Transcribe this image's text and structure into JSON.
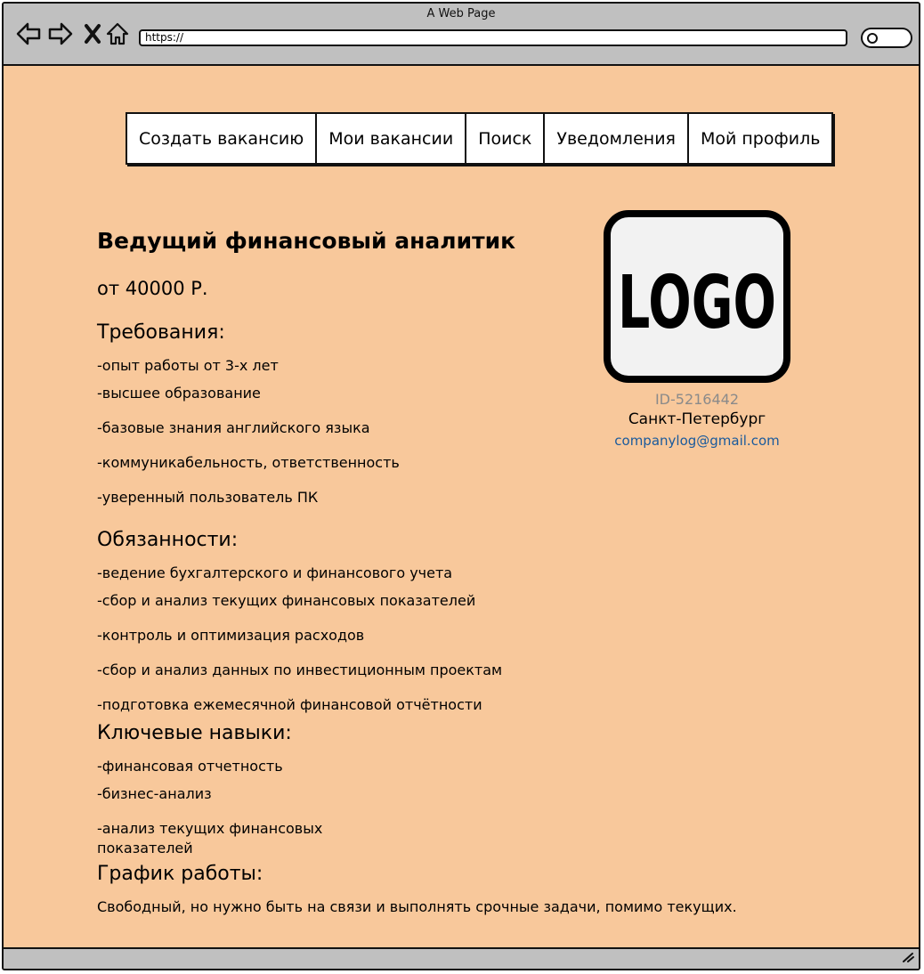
{
  "browser": {
    "title": "A Web Page",
    "url": "https://"
  },
  "menu": [
    {
      "label": "Создать вакансию"
    },
    {
      "label": "Мои вакансии"
    },
    {
      "label": "Поиск"
    },
    {
      "label": "Уведомления"
    },
    {
      "label": "Мой профиль"
    }
  ],
  "job": {
    "title": "Ведущий финансовый аналитик",
    "salary": "от 40000 Р."
  },
  "sections": {
    "requirements": {
      "title": "Требования:",
      "items": [
        "-опыт работы от 3-х лет",
        "-высшее образование",
        "-базовые знания английского языка",
        "-коммуникабельность, ответственность",
        "-уверенный пользователь ПК"
      ]
    },
    "duties": {
      "title": "Обязанности:",
      "items": [
        "-ведение бухгалтерского и финансового учета",
        "-сбор и анализ текущих финансовых показателей",
        "-контроль и оптимизация расходов",
        "-сбор и анализ данных по инвестиционным проектам",
        "-подготовка ежемесячной финансовой отчётности"
      ]
    },
    "skills": {
      "title": "Ключевые навыки:",
      "items": [
        "-финансовая отчетность",
        "-бизнес-анализ",
        "-анализ текущих финансовых",
        "показателей"
      ]
    },
    "schedule": {
      "title": "График работы:",
      "text": "Свободный, но нужно быть на связи и выполнять срочные задачи, помимо текущих."
    }
  },
  "company": {
    "logo_text": "LOGO",
    "id": "ID-5216442",
    "city": "Санкт-Петербург",
    "email": "companylog@gmail.com"
  },
  "colors": {
    "page_bg": "#f8c89b",
    "chrome_bg": "#c0c0c0",
    "link": "#1a5a9c",
    "muted": "#8a8a8a"
  },
  "icons": [
    "back-arrow-icon",
    "forward-arrow-icon",
    "close-icon",
    "home-icon",
    "search-icon",
    "resize-grip-icon"
  ]
}
